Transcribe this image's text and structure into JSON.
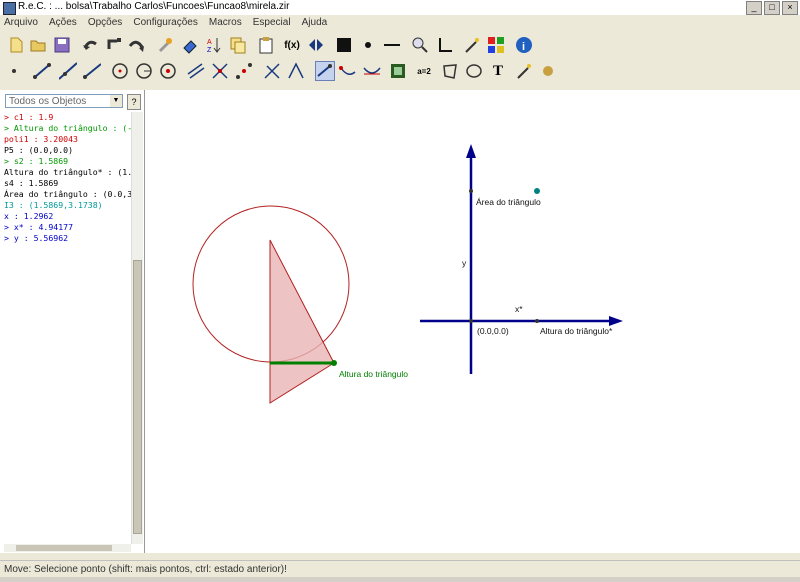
{
  "window": {
    "title": "R.e.C. : ... bolsa\\Trabalho Carlos\\Funcoes\\Funcao8\\mirela.zir"
  },
  "menu": [
    "Arquivo",
    "Ações",
    "Opções",
    "Configurações",
    "Macros",
    "Especial",
    "Ajuda"
  ],
  "toolbar1": [
    {
      "name": "new-file-icon"
    },
    {
      "name": "open-folder-icon"
    },
    {
      "name": "save-icon"
    },
    {
      "name": "undo-icon"
    },
    {
      "name": "undo-point-icon"
    },
    {
      "name": "redo-icon"
    },
    {
      "name": "wrench-icon"
    },
    {
      "name": "eraser-icon"
    },
    {
      "name": "sort-icon"
    },
    {
      "name": "copy-icon"
    },
    {
      "name": "clipboard-icon"
    },
    {
      "name": "function-icon",
      "label": "f(x)"
    },
    {
      "name": "arrows-icon"
    },
    {
      "name": "black-square-icon"
    },
    {
      "name": "dot-icon"
    },
    {
      "name": "line-thickness-icon"
    },
    {
      "name": "zoom-icon"
    },
    {
      "name": "axes-icon"
    },
    {
      "name": "magic-wand-icon"
    },
    {
      "name": "palette-icon"
    },
    {
      "name": "info-icon",
      "label": "i"
    }
  ],
  "toolbar2": [
    {
      "name": "point-tool-icon"
    },
    {
      "name": "segment-tool-icon"
    },
    {
      "name": "line-tool-icon"
    },
    {
      "name": "ray-tool-icon"
    },
    {
      "name": "circle-tool-icon"
    },
    {
      "name": "circle-center-tool-icon"
    },
    {
      "name": "circle-radius-tool-icon"
    },
    {
      "name": "parallel-tool-icon"
    },
    {
      "name": "intersection-tool-icon"
    },
    {
      "name": "midpoint-tool-icon"
    },
    {
      "name": "perpendicular-tool-icon"
    },
    {
      "name": "angle-tool-icon"
    },
    {
      "name": "move-tool-icon",
      "selected": true
    },
    {
      "name": "locus-tool-icon"
    },
    {
      "name": "trace-tool-icon"
    },
    {
      "name": "film-icon"
    },
    {
      "name": "equation-icon",
      "label": "a=2"
    },
    {
      "name": "polygon-tool-icon"
    },
    {
      "name": "ellipse-tool-icon"
    },
    {
      "name": "text-tool-icon",
      "label": "T"
    },
    {
      "name": "wand-tool-icon"
    },
    {
      "name": "ball-icon"
    }
  ],
  "object_panel": {
    "filter": "Todos os Objetos",
    "help_label": "?",
    "items": [
      {
        "text": "> c1 : 1.9",
        "color": "#cc0000"
      },
      {
        "text": "> Altura do triângulo : (-",
        "color": "#009900"
      },
      {
        "text": "poli1 : 3.20043",
        "color": "#cc0000"
      },
      {
        "text": "P5 : (0.0,0.0)",
        "color": "#000000"
      },
      {
        "text": "> s2 : 1.5869",
        "color": "#009900"
      },
      {
        "text": "Altura do triângulo* : (1.",
        "color": "#000000"
      },
      {
        "text": "s4 : 1.5869",
        "color": "#000000"
      },
      {
        "text": "Área do triângulo : (0.0,3",
        "color": "#000000"
      },
      {
        "text": "I3 : (1.5869,3.1738)",
        "color": "#009999"
      },
      {
        "text": "x : 1.2962",
        "color": "#0000cc"
      },
      {
        "text": "> x* : 4.94177",
        "color": "#0000cc"
      },
      {
        "text": "> y : 5.56962",
        "color": "#0000cc"
      }
    ]
  },
  "canvas": {
    "label_altura": "Altura do triângulo",
    "label_area": "Área do triângulo",
    "label_altura_star": "Altura do triângulo*",
    "label_origin": "(0.0,0.0)",
    "label_y": "y",
    "label_xstar": "x*",
    "colors": {
      "circle": "#b22222",
      "triangle_fill": "#e8b4b4",
      "segment": "#008000",
      "axes": "#00008b",
      "point": "#008080"
    }
  },
  "status": "Move: Selecione ponto (shift: mais pontos, ctrl: estado anterior)!"
}
